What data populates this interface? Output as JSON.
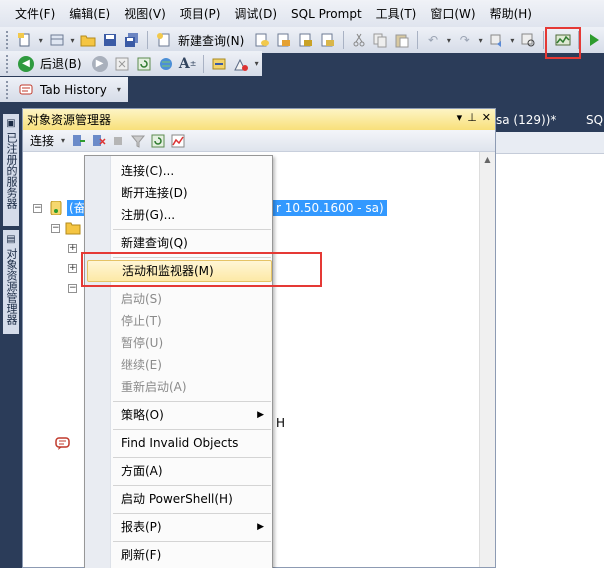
{
  "menubar": {
    "items": [
      "文件(F)",
      "编辑(E)",
      "视图(V)",
      "项目(P)",
      "调试(D)",
      "SQL Prompt",
      "工具(T)",
      "窗口(W)",
      "帮助(H)"
    ]
  },
  "toolbar1": {
    "new_query_label": "新建查询(N)"
  },
  "toolbar2": {
    "back_label": "后退(B)",
    "font_glyph": "A"
  },
  "toolbar3": {
    "tab_history_label": "Tab History"
  },
  "sidetabs": {
    "registered_servers": "已注册的服务器",
    "object_explorer": "对象资源管理器"
  },
  "doc_tabs": [
    "sa (129))*",
    "SQ"
  ],
  "object_explorer": {
    "title": "对象资源管理器",
    "title_controls": [
      "▾",
      "⊥",
      "✕"
    ],
    "connect_label": "连接",
    "root_label": "(奋",
    "root_label_right": "r 10.50.1600 - sa)",
    "fragment_text": "H"
  },
  "context_menu": {
    "items": [
      {
        "label": "连接(C)...",
        "enabled": true
      },
      {
        "label": "断开连接(D)",
        "enabled": true
      },
      {
        "label": "注册(G)...",
        "enabled": true
      },
      {
        "label": "新建查询(Q)",
        "enabled": true
      },
      {
        "label": "活动和监视器(M)",
        "enabled": true,
        "highlighted": true
      },
      {
        "label": "启动(S)",
        "enabled": false
      },
      {
        "label": "停止(T)",
        "enabled": false
      },
      {
        "label": "暂停(U)",
        "enabled": false
      },
      {
        "label": "继续(E)",
        "enabled": false
      },
      {
        "label": "重新启动(A)",
        "enabled": false
      },
      {
        "label": "策略(O)",
        "enabled": true,
        "submenu": true
      },
      {
        "label": "Find Invalid Objects",
        "enabled": true,
        "icon": "sql-prompt-icon"
      },
      {
        "label": "方面(A)",
        "enabled": true
      },
      {
        "label": "启动 PowerShell(H)",
        "enabled": true
      },
      {
        "label": "报表(P)",
        "enabled": true,
        "submenu": true
      },
      {
        "label": "刷新(F)",
        "enabled": true
      }
    ]
  },
  "colors": {
    "dark_background": "#2b3c59",
    "highlight_red": "#e53935",
    "selection_blue": "#3399ff",
    "panel_title_yellow": "#f8e07a"
  }
}
